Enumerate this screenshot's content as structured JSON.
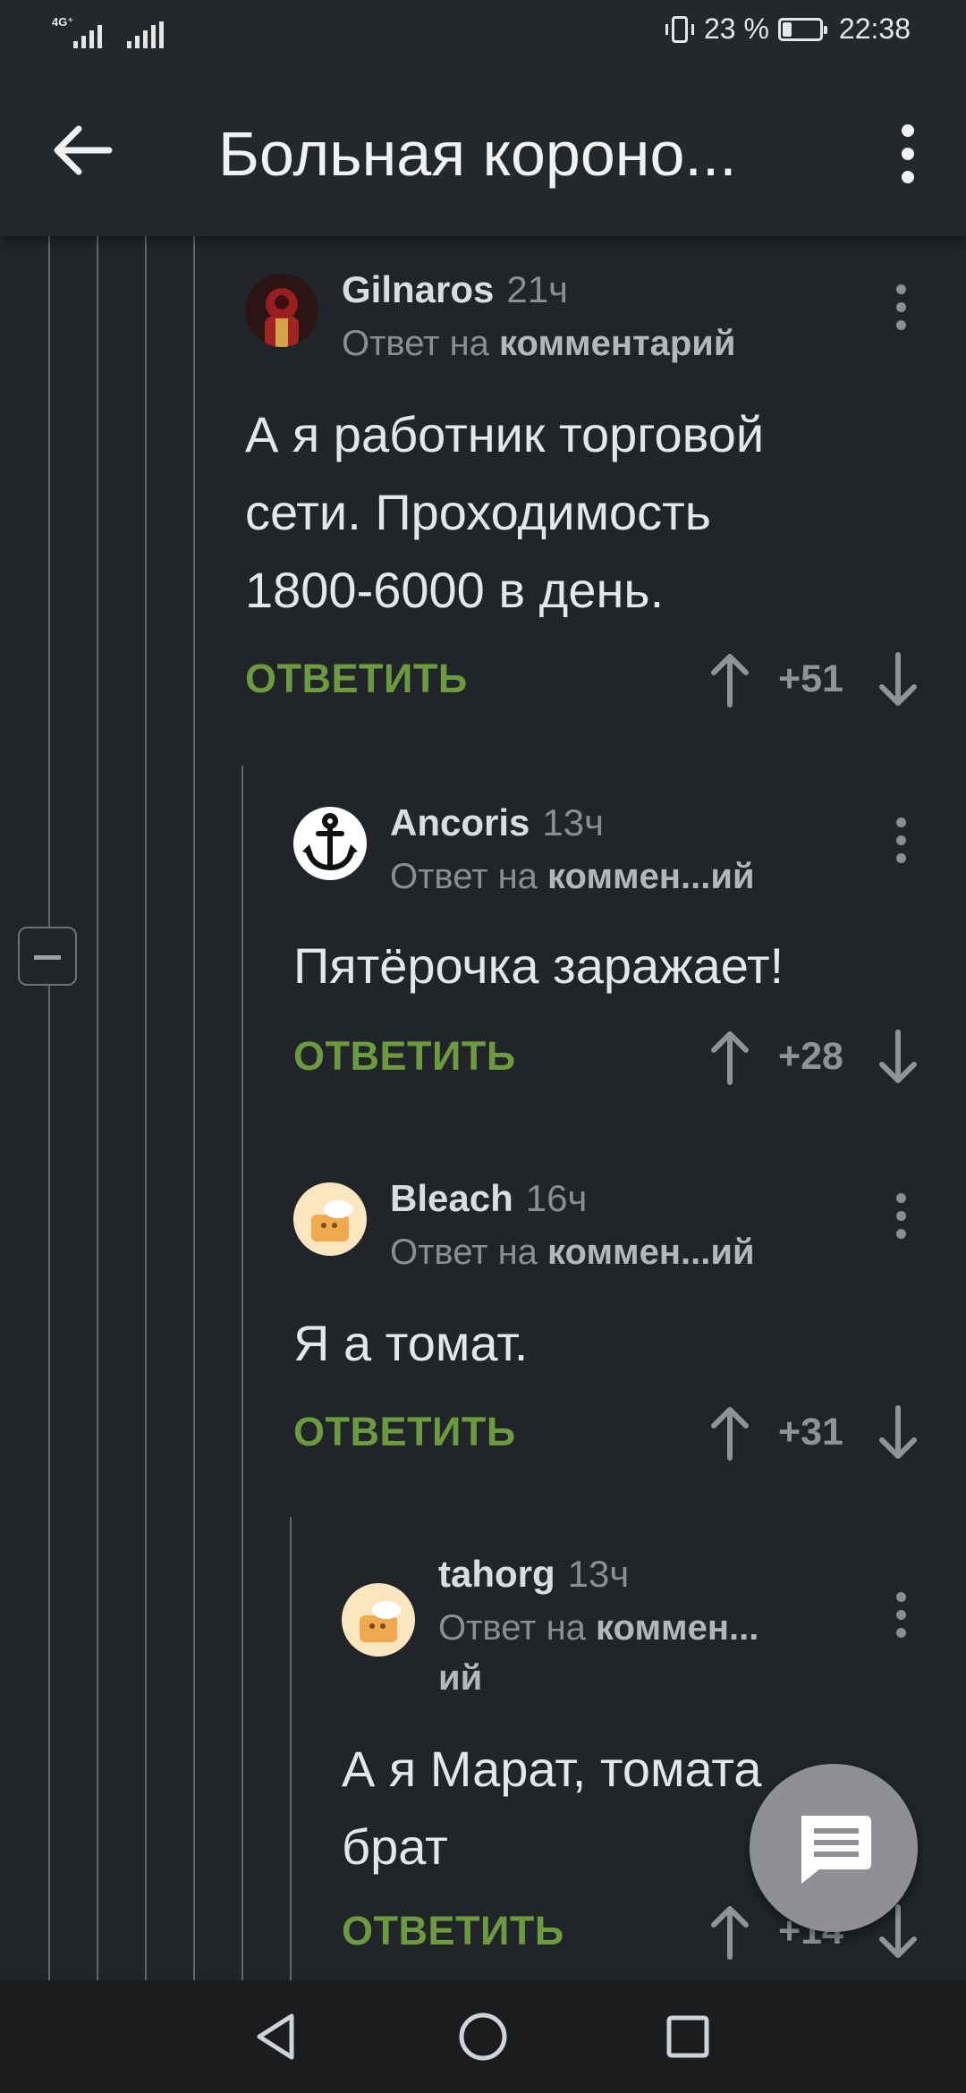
{
  "status_bar": {
    "network_label": "4G⁺",
    "battery_percent": "23 %",
    "battery_level": 0.23,
    "time": "22:38"
  },
  "app_bar": {
    "title": "Больная короно..."
  },
  "comments": [
    {
      "author": "Gilnaros",
      "time": "21ч",
      "reply_prefix": "Ответ на",
      "reply_target": "комментарий",
      "text_lines": [
        "А я работник торговой",
        "сети. Проходимость",
        "1800-6000 в день."
      ],
      "reply_label": "ОТВЕТИТЬ",
      "score": "+51"
    },
    {
      "author": "Ancoris",
      "time": "13ч",
      "reply_prefix": "Ответ на",
      "reply_target": "коммен...ий",
      "text_lines": [
        "Пятёрочка заражает!"
      ],
      "reply_label": "ОТВЕТИТЬ",
      "score": "+28"
    },
    {
      "author": "Bleach",
      "time": "16ч",
      "reply_prefix": "Ответ на",
      "reply_target": "коммен...ий",
      "text_lines": [
        "Я а томат."
      ],
      "reply_label": "ОТВЕТИТЬ",
      "score": "+31"
    },
    {
      "author": "tahorg",
      "time": "13ч",
      "reply_prefix": "Ответ на",
      "reply_target": "коммен...",
      "reply_target_cont": "ий",
      "text_lines": [
        "А я Марат, томата",
        "брат"
      ],
      "reply_label": "ОТВЕТИТЬ",
      "score": "+14"
    }
  ],
  "colors": {
    "background": "#21252a",
    "bar": "#23282c",
    "accent_green": "#6b9a3f",
    "muted_text": "#8a8e93",
    "fab": "#8e9093"
  },
  "icons": {
    "back": "arrow-left-icon",
    "overflow": "more-vertical-icon",
    "upvote": "arrow-up-icon",
    "downvote": "arrow-down-icon",
    "fab": "comment-icon",
    "collapse": "minus-square-icon"
  }
}
